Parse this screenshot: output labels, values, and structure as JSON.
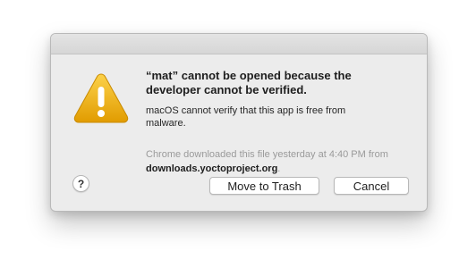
{
  "dialog": {
    "title": "“mat” cannot be opened because the developer cannot be verified.",
    "message": "macOS cannot verify that this app is free from malware.",
    "source_prefix": "Chrome downloaded this file yesterday at 4:40 PM from",
    "source_domain": "downloads.yoctoproject.org",
    "source_suffix": ".",
    "icon": "warning-icon",
    "help_label": "?",
    "buttons": {
      "move_to_trash": "Move to Trash",
      "cancel": "Cancel"
    },
    "colors": {
      "background": "#ececec",
      "warning_yellow": "#f2b500"
    }
  }
}
